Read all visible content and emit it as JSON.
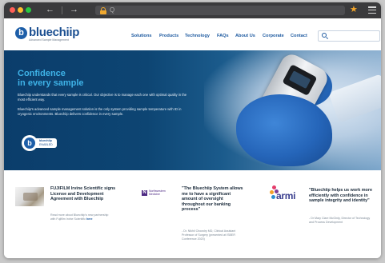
{
  "browser": {
    "back_icon": "arrow-left-icon",
    "forward_icon": "arrow-right-icon",
    "url_placeholder": "Q",
    "bookmark_icon": "star-icon",
    "menu_icon": "hamburger-menu-icon",
    "colors": {
      "chrome": "#3a3a3c",
      "lock": "#f0a930",
      "star": "#f4a62a"
    }
  },
  "site": {
    "logo_text": "bluechiip",
    "logo_mark": "b",
    "logo_tagline": "Advanced Sample Management",
    "nav": [
      "Solutions",
      "Products",
      "Technology",
      "FAQs",
      "About Us",
      "Corporate",
      "Contact"
    ],
    "search_placeholder": "",
    "colors": {
      "brand": "#1b4f91",
      "nav": "#1e5aa0",
      "hero_title": "#3fb3e8"
    }
  },
  "hero": {
    "title_line1": "Confidence",
    "title_line2": "in every sample",
    "paragraph1": "Bluechiip understands that every sample is critical. Our objective is to manage each one with optimal quality in the most efficient way.",
    "paragraph2": "Bluechiip's advanced sample management solution is the only system providing sample temperature with ID in cryogenic environments. Bluechiip delivers confidence in every sample.",
    "badge_line1": "bluechiip",
    "badge_line2": "ENABLED",
    "badge_mark": "b"
  },
  "cards": [
    {
      "title": "FUJIFILM Irvine Scientific signs License and Development Agreement with Bluechiip",
      "body": "Read more about Bluechiip's new partnership with Fujifilm Irvine Scientific",
      "link": "here"
    },
    {
      "logo_line1": "Northwestern",
      "logo_line2": "Medicine",
      "logo_mark": "N",
      "title": "\"The Bluechiip System allows me to have a significant amount of oversight throughout our banking process\"",
      "body": "- Dr. Nikhil Chowdry MD, Clinical Assistant Professor of Surgery (presented at ISBER Conference 2020)"
    },
    {
      "logo_text": "armi",
      "title": "\"Bluechiip helps us work more efficiently with confidence in sample integrity and identity\"",
      "body": "- Dr Mary Clare McGinty, Director of Technology and Process Development"
    }
  ]
}
